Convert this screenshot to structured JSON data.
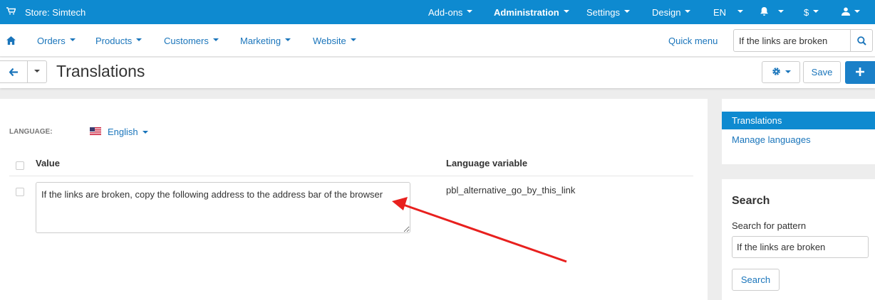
{
  "colors": {
    "topbar": "#0e8ad0",
    "link": "#1a75bb",
    "annotation_arrow": "#e8201e"
  },
  "topbar": {
    "store_icon": "cart-icon",
    "store_label": "Store: Simtech",
    "menus": [
      {
        "label": "Add-ons"
      },
      {
        "label": "Administration"
      },
      {
        "label": "Settings"
      },
      {
        "label": "Design"
      },
      {
        "label": "EN"
      }
    ],
    "bell_icon": "bell-icon",
    "currency_symbol": "$",
    "user_icon": "user-icon"
  },
  "nav": {
    "home_icon": "home-icon",
    "items": [
      {
        "label": "Orders"
      },
      {
        "label": "Products"
      },
      {
        "label": "Customers"
      },
      {
        "label": "Marketing"
      },
      {
        "label": "Website"
      }
    ],
    "quick_menu": "Quick menu",
    "search_value": "If the links are broken",
    "search_icon": "search-icon"
  },
  "header": {
    "title": "Translations",
    "save_label": "Save",
    "back_icon": "arrow-left-icon",
    "settings_icon": "gear-icon",
    "add_icon": "plus-icon"
  },
  "content": {
    "language_label": "LANGUAGE:",
    "language_value": "English",
    "flag_icon": "us-flag-icon",
    "columns": {
      "value": "Value",
      "variable": "Language variable"
    },
    "rows": [
      {
        "value": "If the links are broken, copy the following address to the address bar of the browser",
        "variable": "pbl_alternative_go_by_this_link"
      }
    ]
  },
  "sidebar": {
    "nav": [
      {
        "label": "Translations",
        "active": true
      },
      {
        "label": "Manage languages",
        "active": false
      }
    ],
    "search": {
      "title": "Search",
      "label": "Search for pattern",
      "value": "If the links are broken",
      "button": "Search"
    }
  }
}
